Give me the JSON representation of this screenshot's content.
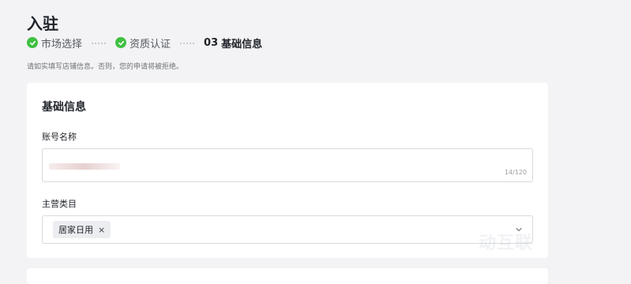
{
  "page": {
    "title": "入驻",
    "notice": "请如实填写店铺信息。否则，您的申请将被拒绝。"
  },
  "steps": [
    {
      "label": "市场选择",
      "status": "done"
    },
    {
      "label": "资质认证",
      "status": "done"
    },
    {
      "number": "03",
      "label": "基础信息",
      "status": "current"
    }
  ],
  "form": {
    "section_title": "基础信息",
    "account_name": {
      "label": "账号名称",
      "value": "",
      "counter": "14/120"
    },
    "main_category": {
      "label": "主营类目",
      "tags": [
        "居家日用"
      ],
      "tag_remove_glyph": "×"
    }
  },
  "watermark": "动互联",
  "colors": {
    "accent_green": "#3fc142",
    "text_primary": "#1f2329",
    "background": "#f3f3f5"
  }
}
